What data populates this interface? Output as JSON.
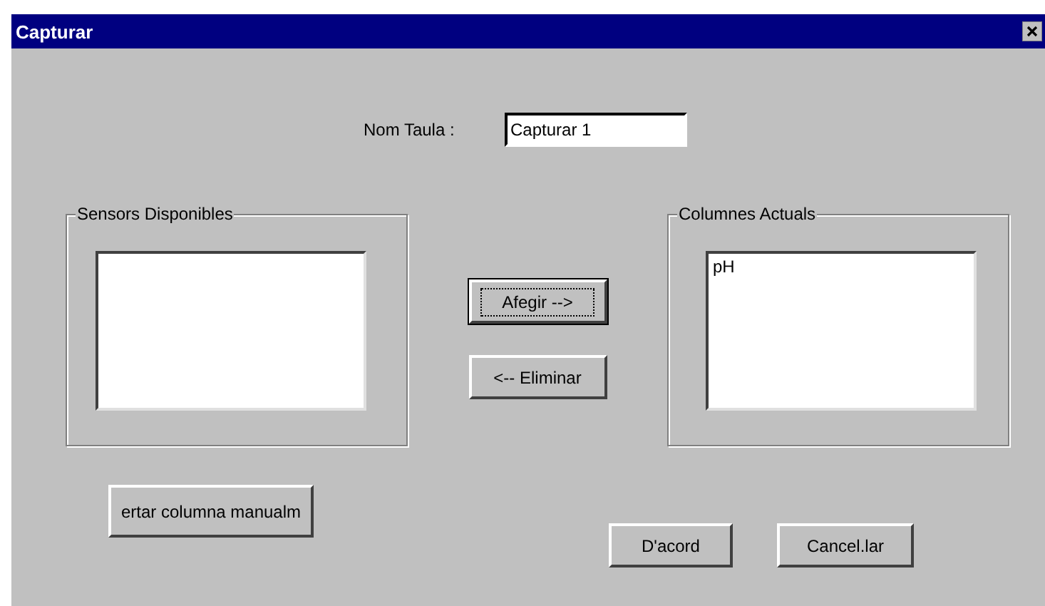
{
  "window": {
    "title": "Capturar"
  },
  "name_field": {
    "label": "Nom Taula :",
    "value": "Capturar 1"
  },
  "available_sensors": {
    "title": "Sensors Disponibles"
  },
  "move_buttons": [
    {
      "label": "Afegir -->",
      "default": true
    },
    {
      "label": "<-- Eliminar",
      "default": false
    }
  ],
  "current_columns": {
    "title": "Columnes Actuals",
    "items": [
      {
        "label": "pH",
        "selected": false
      }
    ]
  },
  "manual_button": {
    "label": "ertar columna manualm"
  },
  "dialog_buttons": [
    {
      "label": "D'acord",
      "default": false
    },
    {
      "label": "Cancel.lar",
      "default": false
    }
  ]
}
